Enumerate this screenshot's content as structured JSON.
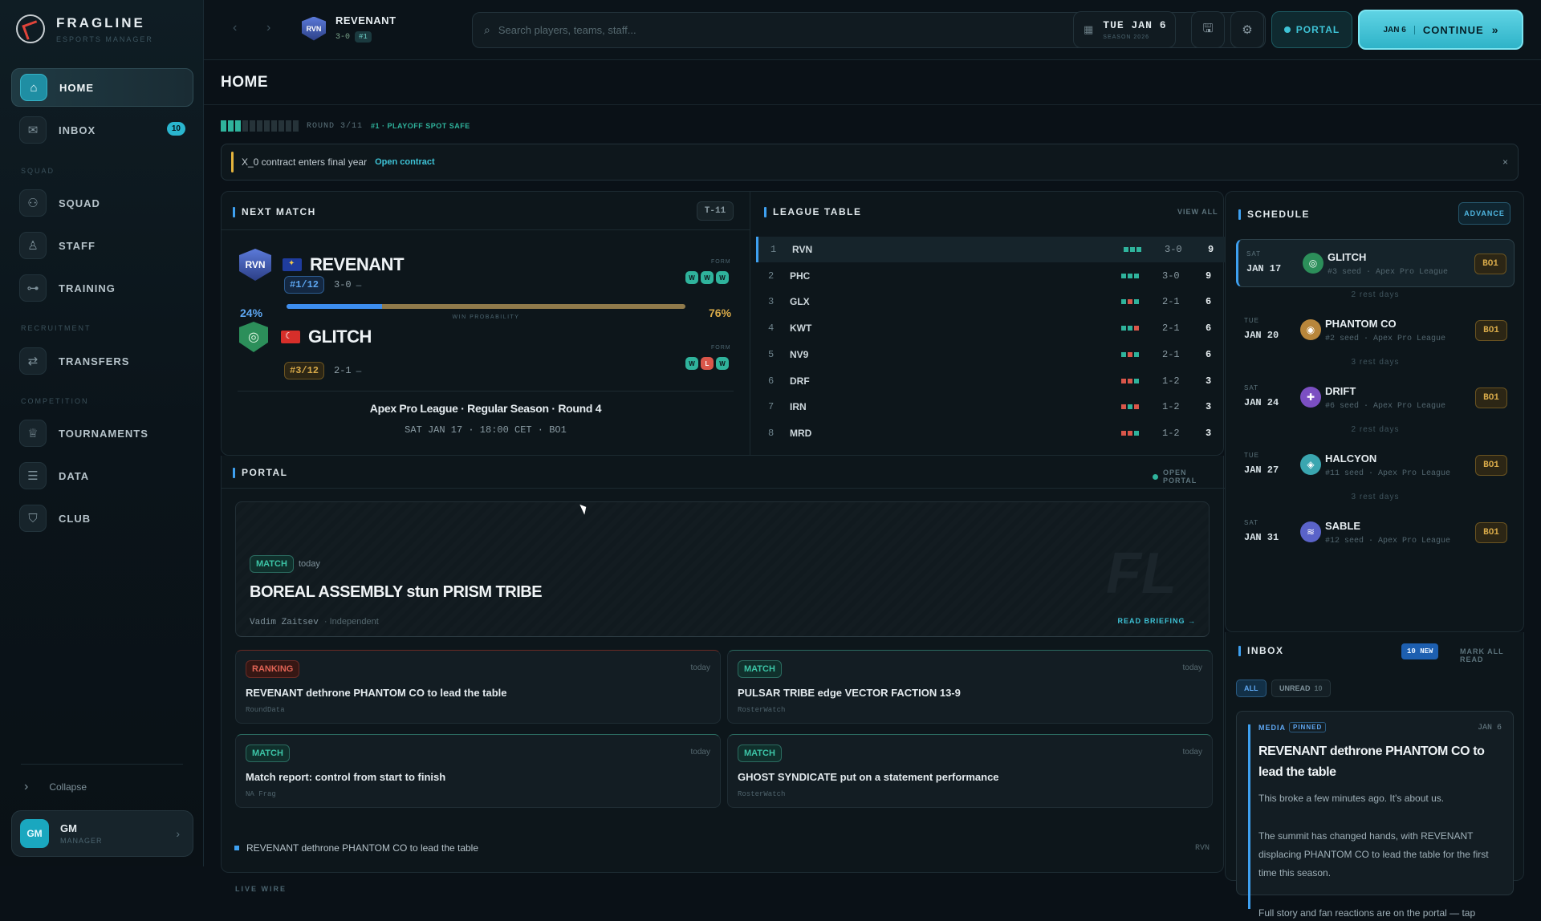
{
  "app": {
    "title": "FRAGLINE",
    "subtitle": "ESPORTS MANAGER"
  },
  "sidebar": {
    "items": [
      {
        "label": "HOME",
        "icon": "home-icon",
        "active": true
      },
      {
        "label": "INBOX",
        "icon": "mail-icon",
        "badge": "10"
      },
      {
        "label": "SQUAD",
        "icon": "users-icon"
      },
      {
        "label": "STAFF",
        "icon": "person-icon"
      },
      {
        "label": "TRAINING",
        "icon": "dumbbell-icon"
      },
      {
        "label": "TRANSFERS",
        "icon": "swap-icon"
      },
      {
        "label": "TOURNAMENTS",
        "icon": "trophy-icon"
      },
      {
        "label": "DATA",
        "icon": "database-icon"
      },
      {
        "label": "CLUB",
        "icon": "shield-icon"
      }
    ],
    "sections": [
      "SQUAD",
      "RECRUITMENT",
      "COMPETITION"
    ],
    "collapse_label": "Collapse",
    "user": {
      "initials": "GM",
      "name": "GM",
      "role": "MANAGER"
    }
  },
  "topbar": {
    "team": {
      "abbr": "RVN",
      "name": "REVENANT",
      "record": "3-0",
      "rank": "#1"
    },
    "search_placeholder": "Search players, teams, staff...",
    "date": {
      "main": "TUE JAN 6",
      "sub": "SEASON 2026"
    },
    "portal_label": "PORTAL",
    "continue": {
      "date": "JAN 6",
      "label": "CONTINUE",
      "icon": "double-chevron-icon"
    }
  },
  "page": {
    "title": "HOME",
    "round": {
      "text": "ROUND 3/11",
      "note": "#1 · PLAYOFF SPOT SAFE",
      "done": 3,
      "total": 11
    },
    "alert": {
      "text": "X_0 contract enters final year",
      "link": "Open contract",
      "close": "×"
    }
  },
  "next_match": {
    "title": "NEXT MATCH",
    "countdown": "T-11",
    "home": {
      "abbr": "RVN",
      "name": "REVENANT",
      "rank": "#1/12",
      "record": "3-0",
      "dash": "–",
      "form": [
        "W",
        "W",
        "W"
      ]
    },
    "away": {
      "name": "GLITCH",
      "rank": "#3/12",
      "record": "2-1",
      "dash": "–",
      "form": [
        "W",
        "L",
        "W"
      ]
    },
    "form_label": "FORM",
    "win_prob": {
      "label": "WIN PROBABILITY",
      "home": "24%",
      "away": "76%",
      "home_value": 24
    },
    "competition": "Apex Pro League · Regular Season · Round 4",
    "when": "SAT JAN 17 · 18:00 CET · BO1"
  },
  "league_table": {
    "title": "LEAGUE TABLE",
    "link": "VIEW ALL",
    "rows": [
      {
        "pos": "1",
        "team": "RVN",
        "form": [
          "W",
          "W",
          "W"
        ],
        "rec": "3-0",
        "pts": "9"
      },
      {
        "pos": "2",
        "team": "PHC",
        "form": [
          "W",
          "W",
          "W"
        ],
        "rec": "3-0",
        "pts": "9"
      },
      {
        "pos": "3",
        "team": "GLX",
        "form": [
          "W",
          "L",
          "W"
        ],
        "rec": "2-1",
        "pts": "6"
      },
      {
        "pos": "4",
        "team": "KWT",
        "form": [
          "W",
          "W",
          "L"
        ],
        "rec": "2-1",
        "pts": "6"
      },
      {
        "pos": "5",
        "team": "NV9",
        "form": [
          "W",
          "L",
          "W"
        ],
        "rec": "2-1",
        "pts": "6"
      },
      {
        "pos": "6",
        "team": "DRF",
        "form": [
          "L",
          "L",
          "W"
        ],
        "rec": "1-2",
        "pts": "3"
      },
      {
        "pos": "7",
        "team": "IRN",
        "form": [
          "L",
          "W",
          "L"
        ],
        "rec": "1-2",
        "pts": "3"
      },
      {
        "pos": "8",
        "team": "MRD",
        "form": [
          "L",
          "L",
          "W"
        ],
        "rec": "1-2",
        "pts": "3"
      }
    ]
  },
  "schedule": {
    "title": "SCHEDULE",
    "action": "ADVANCE",
    "items": [
      {
        "day": "SAT",
        "date": "JAN 17",
        "team": "GLITCH",
        "meta": "#3 seed · Apex Pro League",
        "bo": "BO1",
        "color": "#2c8f5a",
        "glyph": "◎"
      },
      {
        "rest": "2 rest days"
      },
      {
        "day": "TUE",
        "date": "JAN 20",
        "team": "PHANTOM CO",
        "meta": "#2 seed · Apex Pro League",
        "bo": "BO1",
        "color": "#b8863b",
        "glyph": "◉"
      },
      {
        "rest": "3 rest days"
      },
      {
        "day": "SAT",
        "date": "JAN 24",
        "team": "DRIFT",
        "meta": "#6 seed · Apex Pro League",
        "bo": "BO1",
        "color": "#7b4fc2",
        "glyph": "✚"
      },
      {
        "rest": "2 rest days"
      },
      {
        "day": "TUE",
        "date": "JAN 27",
        "team": "HALCYON",
        "meta": "#11 seed · Apex Pro League",
        "bo": "BO1",
        "color": "#3aa6b0",
        "glyph": "◈"
      },
      {
        "rest": "3 rest days"
      },
      {
        "day": "SAT",
        "date": "JAN 31",
        "team": "SABLE",
        "meta": "#12 seed · Apex Pro League",
        "bo": "BO1",
        "color": "#5a63c9",
        "glyph": "≋"
      }
    ]
  },
  "portal": {
    "title": "PORTAL",
    "link": "OPEN PORTAL",
    "feature": {
      "tag": "MATCH",
      "time": "today",
      "title": "BOREAL ASSEMBLY stun PRISM TRIBE",
      "author": "Vadim Zaitsev",
      "outlet": "· Independent",
      "action": "READ BRIEFING →",
      "watermark": "FL"
    },
    "cards": [
      {
        "tag": "RANKING",
        "kind": "rank",
        "time": "today",
        "title": "REVENANT dethrone PHANTOM CO to lead the table",
        "source": "RoundData"
      },
      {
        "tag": "MATCH",
        "kind": "match",
        "time": "today",
        "title": "PULSAR TRIBE edge VECTOR FACTION 13-9",
        "source": "RosterWatch"
      },
      {
        "tag": "MATCH",
        "kind": "match",
        "time": "today",
        "title": "Match report: control from start to finish",
        "source": "NA Frag"
      },
      {
        "tag": "MATCH",
        "kind": "match",
        "time": "today",
        "title": "GHOST SYNDICATE put on a statement performance",
        "source": "RosterWatch"
      }
    ],
    "live_wire": {
      "label": "LIVE WIRE",
      "items": [
        {
          "text": "REVENANT dethrone PHANTOM CO to lead the table",
          "team": "RVN"
        }
      ]
    }
  },
  "inbox": {
    "title": "INBOX",
    "new_badge": "10 NEW",
    "mark_all": "MARK ALL READ",
    "filters": {
      "all": "ALL",
      "unread": "UNREAD",
      "unread_count": "10"
    },
    "message": {
      "category": "MEDIA",
      "pinned": "PINNED",
      "date": "JAN 6",
      "title": "REVENANT dethrone PHANTOM CO to lead the table",
      "p1": "This broke a few minutes ago. It's about us.",
      "p2": "The summit has changed hands, with REVENANT displacing PHANTOM CO to lead the table for the first time this season.",
      "p3": "Full story and fan reactions are on the portal — tap"
    }
  },
  "colors": {
    "accent": "#3ec3d6",
    "win": "#2fb39c",
    "loss": "#d9564a",
    "gold": "#d8aa49"
  }
}
